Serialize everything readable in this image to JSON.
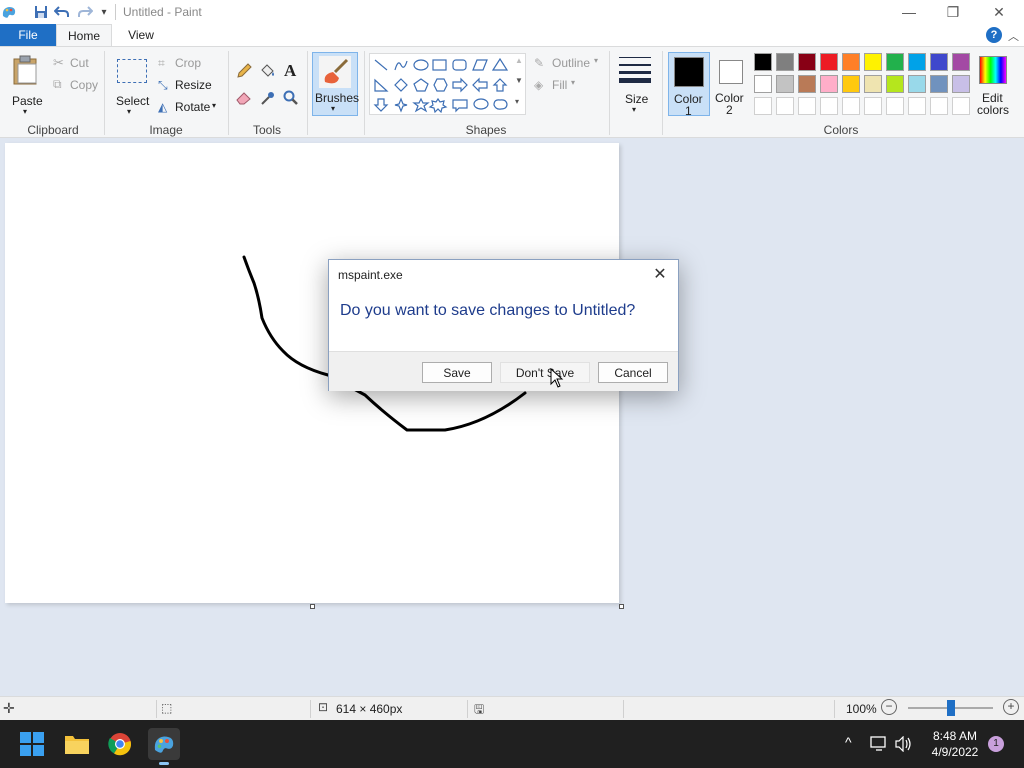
{
  "window": {
    "title": "Untitled - Paint",
    "minimize": "—",
    "restore": "❐",
    "close": "✕"
  },
  "tabs": {
    "file": "File",
    "home": "Home",
    "view": "View",
    "help": "?"
  },
  "ribbon": {
    "clipboard": {
      "label": "Clipboard",
      "paste": "Paste",
      "cut": "Cut",
      "copy": "Copy"
    },
    "image": {
      "label": "Image",
      "select": "Select",
      "crop": "Crop",
      "resize": "Resize",
      "rotate": "Rotate"
    },
    "tools": {
      "label": "Tools"
    },
    "brushes": {
      "label": "Brushes"
    },
    "shapes": {
      "label": "Shapes",
      "outline": "Outline",
      "fill": "Fill"
    },
    "size": {
      "label": "Size"
    },
    "colors": {
      "label": "Colors",
      "color1": "Color\n1",
      "color2": "Color\n2",
      "color1_line1": "Color",
      "color1_line2": "1",
      "color2_line1": "Color",
      "color2_line2": "2",
      "edit_line1": "Edit",
      "edit_line2": "colors",
      "primary": "#000000",
      "secondary": "#ffffff",
      "palette_row1": [
        "#000000",
        "#7f7f7f",
        "#880015",
        "#ed1c24",
        "#ff7f27",
        "#fff200",
        "#22b14c",
        "#00a2e8",
        "#3f48cc",
        "#a349a4"
      ],
      "palette_row2": [
        "#ffffff",
        "#c3c3c3",
        "#b97a57",
        "#ffaec9",
        "#ffc90e",
        "#efe4b0",
        "#b5e61d",
        "#99d9ea",
        "#7092be",
        "#c8bfe7"
      ],
      "palette_row3": [
        "#ffffff",
        "#ffffff",
        "#ffffff",
        "#ffffff",
        "#ffffff",
        "#ffffff",
        "#ffffff",
        "#ffffff",
        "#ffffff",
        "#ffffff"
      ]
    }
  },
  "dialog": {
    "title": "mspaint.exe",
    "message": "Do you want to save changes to Untitled?",
    "save": "Save",
    "dont_save": "Don't Save",
    "cancel": "Cancel"
  },
  "status": {
    "dimensions": "614 × 460px",
    "zoom": "100%",
    "zoom_level_percent": 100
  },
  "taskbar": {
    "time": "8:48 AM",
    "date": "4/9/2022",
    "notification_count": "1"
  }
}
